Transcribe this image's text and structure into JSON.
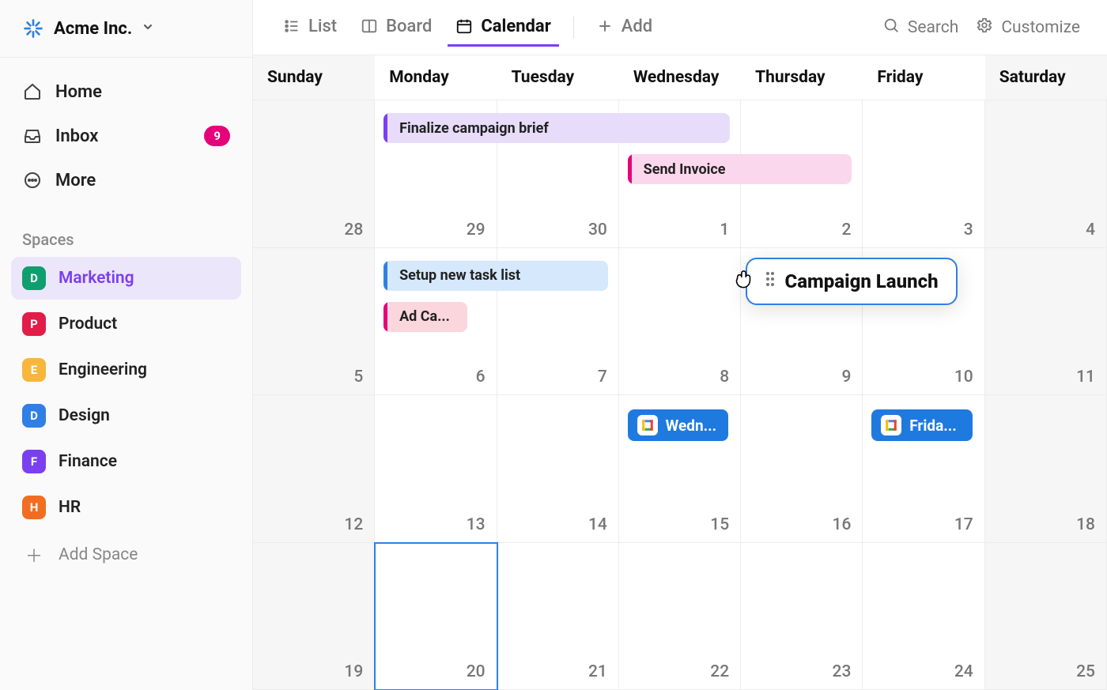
{
  "workspace": {
    "name": "Acme Inc."
  },
  "nav": {
    "home": "Home",
    "inbox": "Inbox",
    "inbox_badge": "9",
    "more": "More"
  },
  "spaces": {
    "title": "Spaces",
    "items": [
      {
        "letter": "D",
        "label": "Marketing",
        "bg": "#0f9f6e",
        "selected": true
      },
      {
        "letter": "P",
        "label": "Product",
        "bg": "#e11d48",
        "selected": false
      },
      {
        "letter": "E",
        "label": "Engineering",
        "bg": "#f6b73c",
        "selected": false
      },
      {
        "letter": "D",
        "label": "Design",
        "bg": "#2f7fe6",
        "selected": false
      },
      {
        "letter": "F",
        "label": "Finance",
        "bg": "#7b3ff2",
        "selected": false
      },
      {
        "letter": "H",
        "label": "HR",
        "bg": "#f26d21",
        "selected": false
      }
    ],
    "add": "Add Space"
  },
  "toolbar": {
    "list": "List",
    "board": "Board",
    "calendar": "Calendar",
    "add": "Add",
    "search": "Search",
    "customize": "Customize"
  },
  "calendar": {
    "days": [
      "Sunday",
      "Monday",
      "Tuesday",
      "Wednesday",
      "Thursday",
      "Friday",
      "Saturday"
    ],
    "cells": [
      [
        "28",
        "29",
        "30",
        "1",
        "2",
        "3",
        "4"
      ],
      [
        "5",
        "6",
        "7",
        "8",
        "9",
        "10",
        "11"
      ],
      [
        "12",
        "13",
        "14",
        "15",
        "16",
        "17",
        "18"
      ],
      [
        "19",
        "20",
        "21",
        "22",
        "23",
        "24",
        "25"
      ]
    ],
    "today": {
      "row": 3,
      "col": 1
    },
    "events": {
      "finalize": {
        "label": "Finalize campaign brief",
        "bg": "#e8dcfb",
        "accent": "#7b3ff2"
      },
      "invoice": {
        "label": "Send Invoice",
        "bg": "#fbd7ed",
        "accent": "#e6007a"
      },
      "setup": {
        "label": "Setup new task list",
        "bg": "#d6e8fb",
        "accent": "#2f7fe6"
      },
      "adca": {
        "label": "Ad Ca...",
        "bg": "#fbd6dd",
        "accent": "#e6007a"
      },
      "drag": {
        "label": "Campaign Launch"
      },
      "gc_wed": {
        "label": "Wedn..."
      },
      "gc_fri": {
        "label": "Frida..."
      }
    }
  }
}
